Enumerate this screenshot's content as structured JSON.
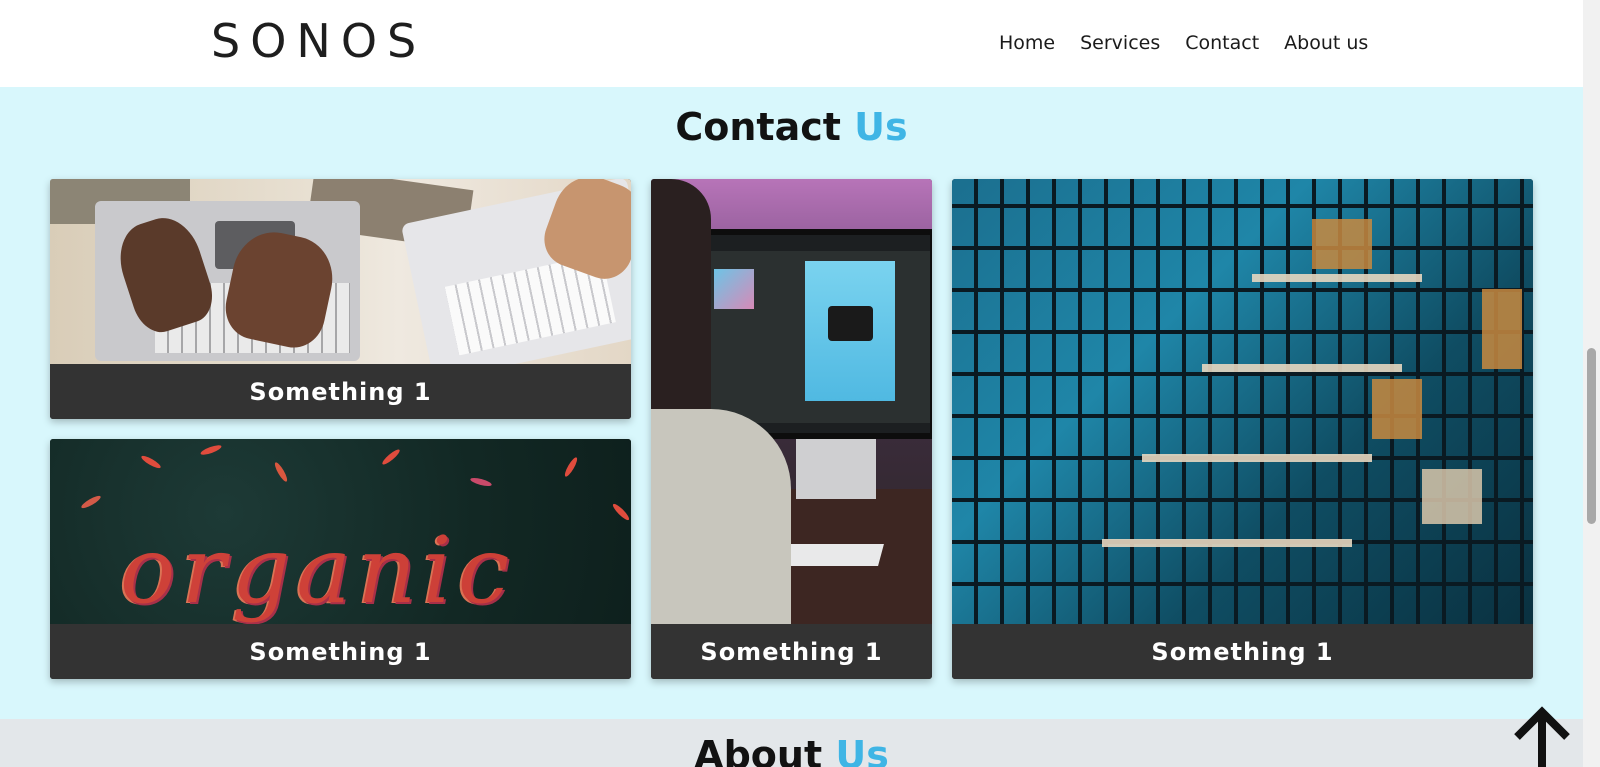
{
  "header": {
    "logo": "SONOS",
    "nav": [
      "Home",
      "Services",
      "Contact",
      "About us"
    ]
  },
  "contact": {
    "title_main": "Contact",
    "title_accent": "Us",
    "cards": [
      {
        "caption": "Something 1",
        "image": "hands-typing-on-laptops"
      },
      {
        "caption": "Something 1",
        "image": "organic-leaves-lettering"
      },
      {
        "caption": "Something 1",
        "image": "photographer-at-computer"
      },
      {
        "caption": "Something 1",
        "image": "glass-building-facade"
      }
    ]
  },
  "about": {
    "title_main": "About",
    "title_accent": "Us"
  },
  "icons": {
    "back_to_top": "arrow-up-icon"
  },
  "colors": {
    "accent": "#3fb5e5",
    "contact_bg": "#d8f7fc",
    "caption_bg": "#333333",
    "about_bg": "#e3e7ea"
  }
}
